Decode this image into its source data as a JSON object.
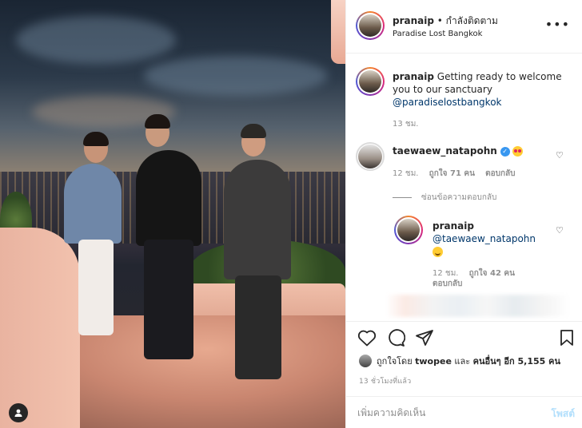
{
  "header": {
    "username": "pranaip",
    "follow_status": "• กำลังติดตาม",
    "location": "Paradise Lost Bangkok",
    "more_label": "•••"
  },
  "caption": {
    "username": "pranaip",
    "text": "Getting ready to welcome you to our sanctuary",
    "mention": "@paradiselostbangkok",
    "time": "13 ชม."
  },
  "comments": [
    {
      "username": "taewaew_natapohn",
      "verified": true,
      "emoji": "smiling-face-with-heart-eyes",
      "time": "12 ชม.",
      "likes": "ถูกใจ 71 คน",
      "reply_label": "ตอบกลับ",
      "hide_replies_label": "ซ่อนข้อความตอบกลับ"
    },
    {
      "username": "pranaip",
      "mention": "@taewaew_natapohn",
      "emoji": "smiling-face",
      "time": "12 ชม.",
      "likes": "ถูกใจ 42 คน",
      "reply_label": "ตอบกลับ"
    }
  ],
  "likes": {
    "prefix": "ถูกใจโดย",
    "user": "twopee",
    "joiner": "และ",
    "others": "คนอื่นๆ อีก 5,155 คน"
  },
  "posted_time": "13 ชั่วโมงที่แล้ว",
  "comment_box": {
    "placeholder": "เพิ่มความคิดเห็น",
    "post_label": "โพสต์"
  },
  "icons": {
    "like": "heart-icon",
    "comment": "comment-icon",
    "share": "paper-plane-icon",
    "save": "bookmark-icon",
    "more": "more-dots-icon",
    "user_tag": "user-tag-icon"
  },
  "colors": {
    "text": "#262626",
    "muted": "#8e8e8e",
    "link": "#00376b",
    "verified": "#3897f0",
    "post_disabled": "#b2dffc"
  }
}
